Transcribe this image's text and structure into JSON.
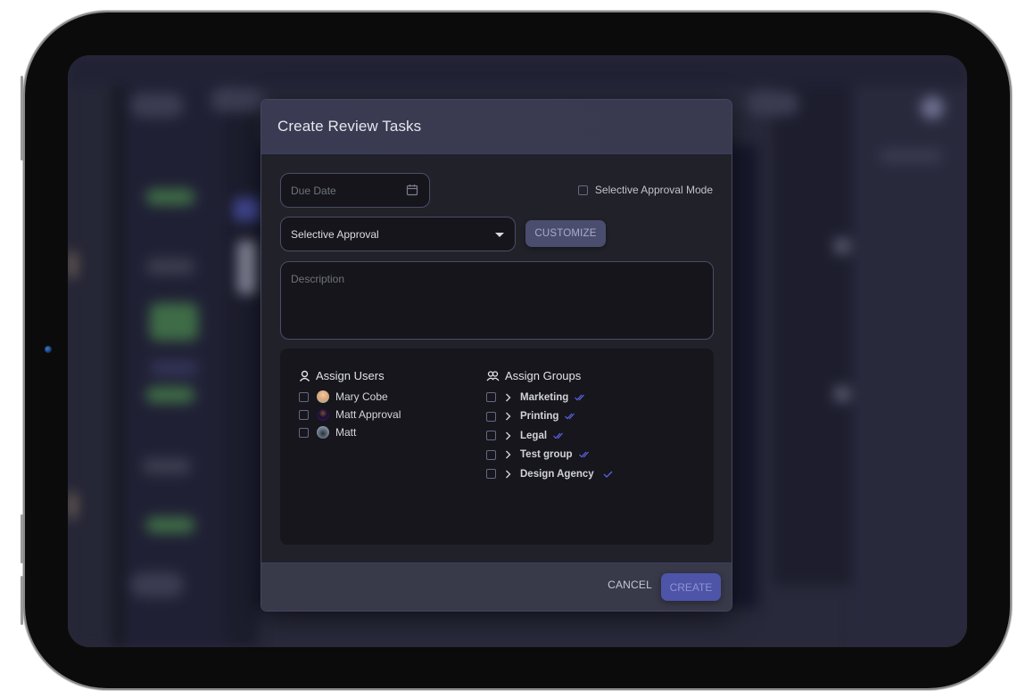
{
  "dialog": {
    "title": "Create Review Tasks",
    "due_date": {
      "placeholder": "Due Date",
      "value": "",
      "icon": "calendar-icon"
    },
    "selective_approval_mode": {
      "label": "Selective Approval Mode",
      "checked": false
    },
    "approval_type": {
      "selected": "Selective Approval",
      "icon": "caret-down-icon"
    },
    "customize_label": "CUSTOMIZE",
    "description": {
      "placeholder": "Description",
      "value": ""
    },
    "assign_users": {
      "heading": "Assign Users",
      "icon": "user-icon",
      "items": [
        {
          "name": "Mary Cobe",
          "checked": false,
          "avatar_color": "#d9a57a"
        },
        {
          "name": "Matt Approval",
          "checked": false,
          "avatar_color": "#3a1f6e"
        },
        {
          "name": "Matt",
          "checked": false,
          "avatar_color": "#6f7f8f"
        }
      ]
    },
    "assign_groups": {
      "heading": "Assign Groups",
      "icon": "users-icon",
      "items": [
        {
          "name": "Marketing",
          "checked": false,
          "status_icon": "double-check-icon"
        },
        {
          "name": "Printing",
          "checked": false,
          "status_icon": "double-check-icon"
        },
        {
          "name": "Legal",
          "checked": false,
          "status_icon": "double-check-icon"
        },
        {
          "name": "Test group",
          "checked": false,
          "status_icon": "double-check-icon"
        },
        {
          "name": "Design Agency",
          "checked": false,
          "status_icon": "check-icon"
        }
      ]
    },
    "footer": {
      "cancel_label": "CANCEL",
      "create_label": "CREATE"
    }
  },
  "colors": {
    "accent": "#4e54a8",
    "check_accent": "#5b63e6",
    "modal_bg": "#212229",
    "header_bg": "#3a3b52"
  }
}
